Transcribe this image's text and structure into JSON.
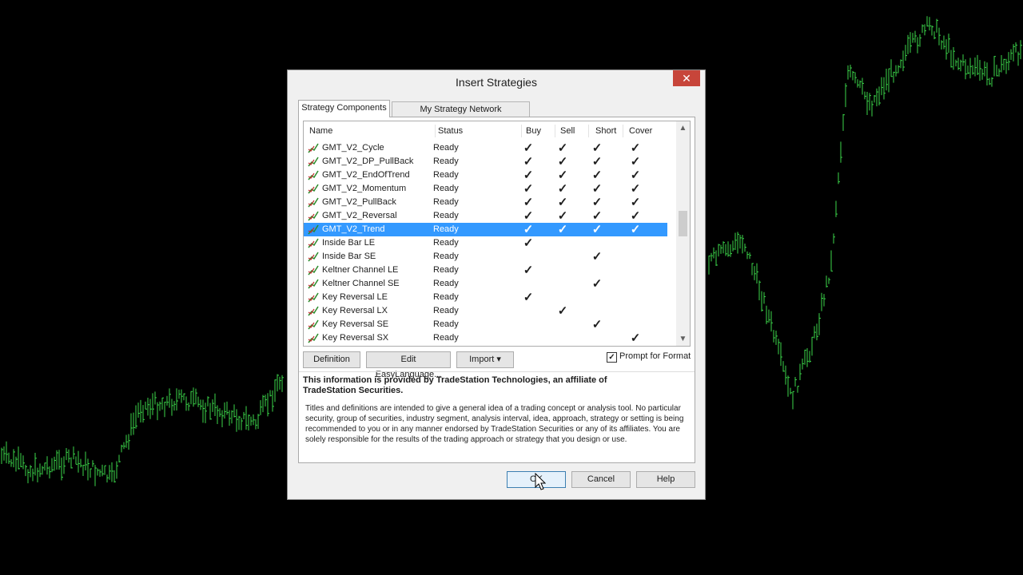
{
  "dialog": {
    "title": "Insert Strategies",
    "close_label": "✕"
  },
  "tabs": [
    {
      "label": "Strategy Components",
      "active": true
    },
    {
      "label": "My Strategy Network Subscriptions",
      "active": false
    }
  ],
  "list": {
    "columns": {
      "name": "Name",
      "status": "Status",
      "buy": "Buy",
      "sell": "Sell",
      "short": "Short",
      "cover": "Cover"
    },
    "rows": [
      {
        "name": "GMT_V2_Cycle",
        "status": "Ready",
        "buy": true,
        "sell": true,
        "short": true,
        "cover": true
      },
      {
        "name": "GMT_V2_DP_PullBack",
        "status": "Ready",
        "buy": true,
        "sell": true,
        "short": true,
        "cover": true
      },
      {
        "name": "GMT_V2_EndOfTrend",
        "status": "Ready",
        "buy": true,
        "sell": true,
        "short": true,
        "cover": true
      },
      {
        "name": "GMT_V2_Momentum",
        "status": "Ready",
        "buy": true,
        "sell": true,
        "short": true,
        "cover": true
      },
      {
        "name": "GMT_V2_PullBack",
        "status": "Ready",
        "buy": true,
        "sell": true,
        "short": true,
        "cover": true
      },
      {
        "name": "GMT_V2_Reversal",
        "status": "Ready",
        "buy": true,
        "sell": true,
        "short": true,
        "cover": true
      },
      {
        "name": "GMT_V2_Trend",
        "status": "Ready",
        "buy": true,
        "sell": true,
        "short": true,
        "cover": true,
        "selected": true
      },
      {
        "name": "Inside Bar LE",
        "status": "Ready",
        "buy": true,
        "sell": false,
        "short": false,
        "cover": false
      },
      {
        "name": "Inside Bar SE",
        "status": "Ready",
        "buy": false,
        "sell": false,
        "short": true,
        "cover": false
      },
      {
        "name": "Keltner Channel LE",
        "status": "Ready",
        "buy": true,
        "sell": false,
        "short": false,
        "cover": false
      },
      {
        "name": "Keltner Channel SE",
        "status": "Ready",
        "buy": false,
        "sell": false,
        "short": true,
        "cover": false
      },
      {
        "name": "Key Reversal LE",
        "status": "Ready",
        "buy": true,
        "sell": false,
        "short": false,
        "cover": false
      },
      {
        "name": "Key Reversal LX",
        "status": "Ready",
        "buy": false,
        "sell": true,
        "short": false,
        "cover": false
      },
      {
        "name": "Key Reversal SE",
        "status": "Ready",
        "buy": false,
        "sell": false,
        "short": true,
        "cover": false
      },
      {
        "name": "Key Reversal SX",
        "status": "Ready",
        "buy": false,
        "sell": false,
        "short": false,
        "cover": true
      }
    ],
    "check_glyph": "✓",
    "icon": "strategy-chart-icon"
  },
  "buttons": {
    "definition": "Definition",
    "edit": "Edit EasyLanguage...",
    "import": "Import ▾",
    "ok": "OK",
    "cancel": "Cancel",
    "help": "Help"
  },
  "prompt_for_format": {
    "label": "Prompt for Format",
    "checked": true
  },
  "info": {
    "heading": "This information is provided by TradeStation Technologies, an affiliate of TradeStation Securities.",
    "body": "Titles and definitions are intended to give a general idea of a trading concept or analysis tool. No particular security, group of securities, industry segment, analysis interval, idea, approach, strategy or setting is being recommended to you or in any manner endorsed by TradeStation Securities or any of its affiliates. You are solely responsible for the results of the trading approach or strategy that you design or use."
  },
  "colors": {
    "background": "#000000",
    "bars": "#3bd64a",
    "selection": "#3399ff"
  }
}
